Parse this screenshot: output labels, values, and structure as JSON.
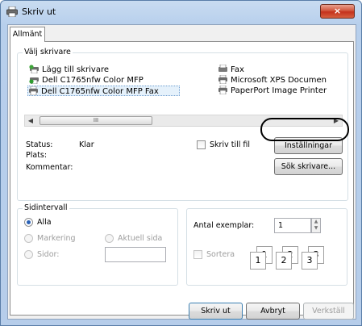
{
  "window": {
    "title": "Skriv ut",
    "close_icon": "×"
  },
  "tab": {
    "label": "Allmänt"
  },
  "printer_group": {
    "legend": "Välj skrivare",
    "printers": [
      {
        "name": "Lägg till skrivare",
        "icon": "add-printer-icon"
      },
      {
        "name": "Dell C1765nfw Color MFP",
        "icon": "default-printer-icon"
      },
      {
        "name": "Dell C1765nfw Color MFP Fax",
        "icon": "printer-icon",
        "selected": true
      },
      {
        "name": "Fax",
        "icon": "fax-icon"
      },
      {
        "name": "Microsoft XPS Documen",
        "icon": "printer-icon"
      },
      {
        "name": "PaperPort Image Printer",
        "icon": "printer-icon"
      }
    ],
    "status_label": "Status:",
    "status_value": "Klar",
    "location_label": "Plats:",
    "comment_label": "Kommentar:",
    "print_to_file_label": "Skriv till fil",
    "preferences_button": "Inställningar",
    "find_printer_button": "Sök skrivare...",
    "scroll_grip": "III"
  },
  "range_group": {
    "legend": "Sidintervall",
    "all_label": "Alla",
    "selection_label": "Markering",
    "current_page_label": "Aktuell sida",
    "pages_label": "Sidor:",
    "pages_value": ""
  },
  "copies_group": {
    "copies_label": "Antal exemplar:",
    "copies_value": "1",
    "collate_label": "Sortera",
    "collate_pages": [
      "1",
      "1",
      "2",
      "2",
      "3",
      "3"
    ]
  },
  "footer": {
    "print_button": "Skriv ut",
    "cancel_button": "Avbryt",
    "apply_button": "Verkställ"
  },
  "colors": {
    "title_gradient": "#c9dcf1",
    "close_button": "#c4321c",
    "radio_dot": "#2a61b5",
    "disabled_text": "#9d9d9d"
  }
}
